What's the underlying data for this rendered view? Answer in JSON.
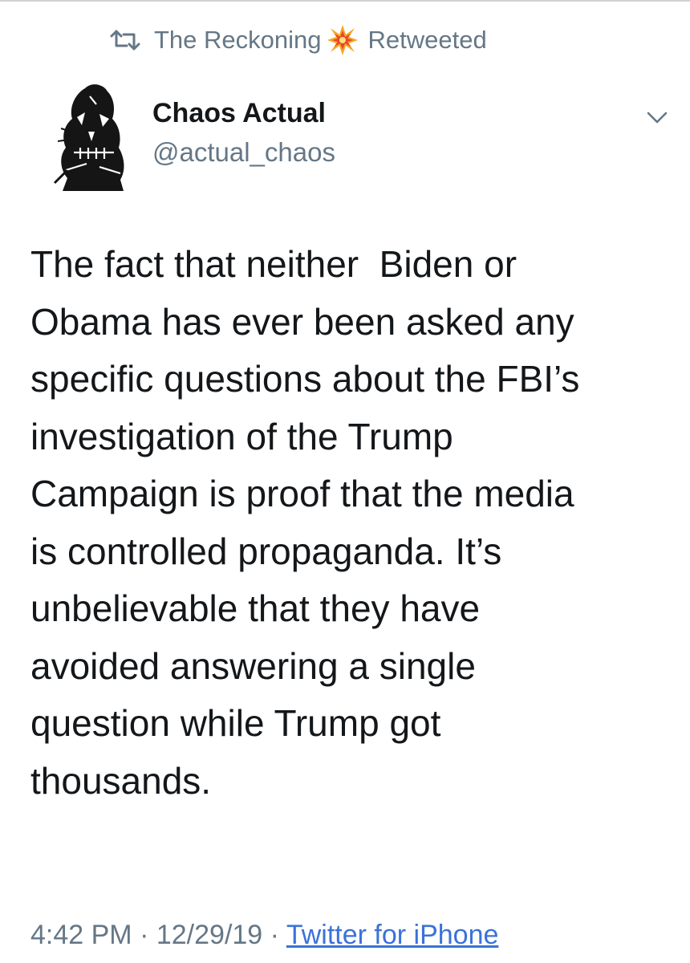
{
  "retweet_context": {
    "retweeter_name": "The Reckoning",
    "label": "Retweeted",
    "icons": [
      "retweet-icon",
      "collision-burst-emoji-icon"
    ]
  },
  "tweet": {
    "author": {
      "display_name": "Chaos Actual",
      "handle": "@actual_chaos",
      "avatar": "skull-drawing-avatar"
    },
    "menu_icon": "chevron-down-icon",
    "text_lines": [
      "The fact that neither  Biden or",
      "Obama has ever been asked any",
      "specific questions about the FBI’s",
      "investigation of the Trump",
      "Campaign is proof that the media",
      "is controlled propaganda. It’s",
      "unbelievable that they have",
      "avoided answering a single",
      "question while Trump got",
      "thousands."
    ],
    "time": "4:42 PM",
    "date": "12/29/19",
    "separator": "·",
    "source": "Twitter for iPhone"
  },
  "colors": {
    "text_primary": "#14171a",
    "text_secondary": "#657786",
    "link": "#3b72d9",
    "background": "#ffffff"
  }
}
